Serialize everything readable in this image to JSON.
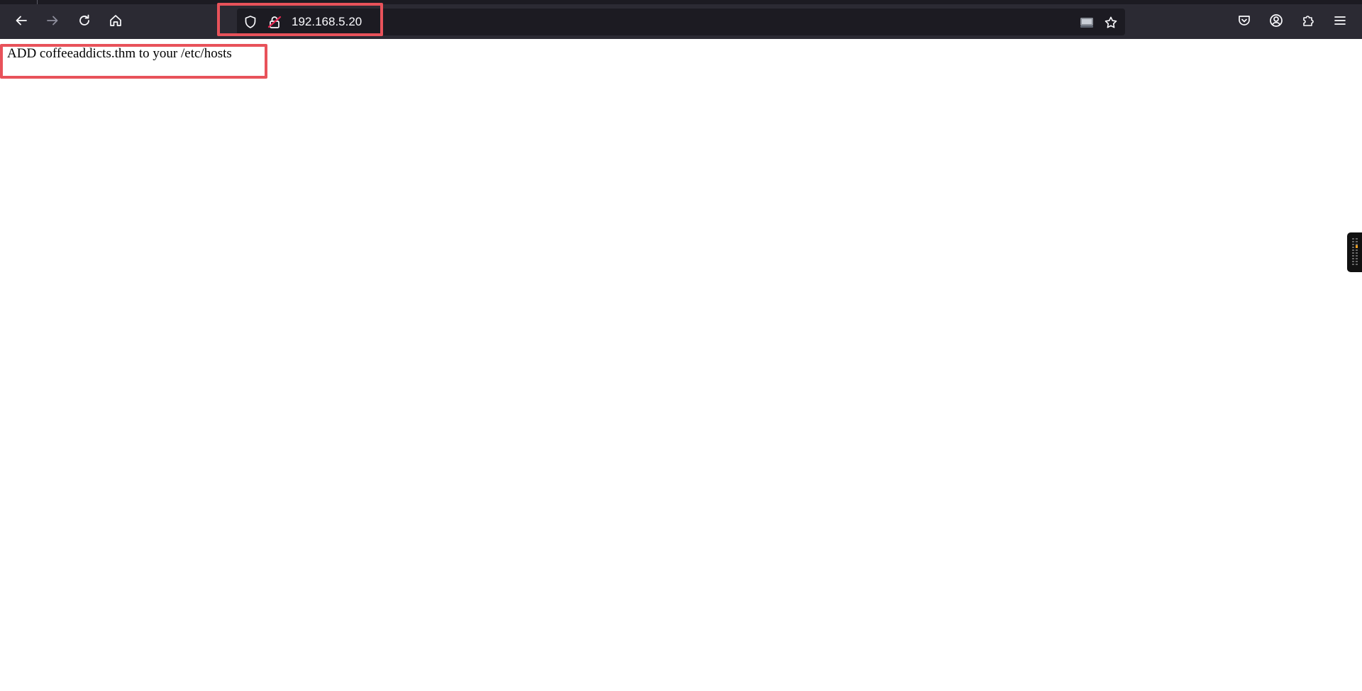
{
  "browser": {
    "url": "192.168.5.20",
    "nav": {
      "back_icon": "back-arrow-icon",
      "forward_icon": "forward-arrow-icon",
      "reload_icon": "reload-icon",
      "home_icon": "home-icon"
    },
    "urlbar_icons": {
      "shield": "tracking-protection-shield-icon",
      "lock": "insecure-lock-icon",
      "reader": "reader-view-icon",
      "bookmark": "bookmark-star-icon"
    },
    "toolbar_right_icons": [
      "pocket-icon",
      "account-icon",
      "extensions-icon",
      "menu-icon"
    ]
  },
  "page": {
    "message": "ADD coffeeaddicts.thm to your /etc/hosts"
  },
  "colors": {
    "toolbar_bg": "#2b2a33",
    "urlbar_bg": "#1c1b22",
    "highlight": "#e8525a",
    "icon": "#fbfbfe"
  }
}
